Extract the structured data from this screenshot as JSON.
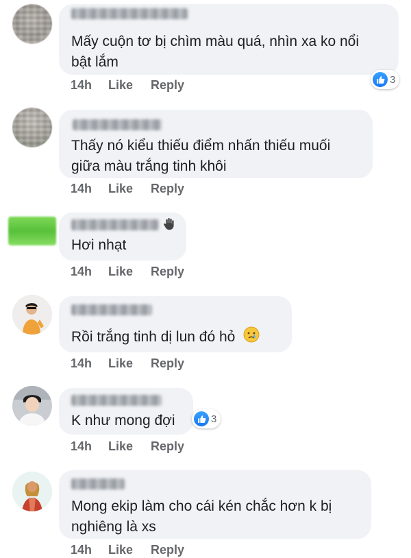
{
  "comments": [
    {
      "text_line1": "Mấy cuộn tơ bị chìm màu quá, nhìn xa ko nổi",
      "text_line2": "bật lắm",
      "time": "14h",
      "like": "Like",
      "reply": "Reply",
      "reaction_count": "3",
      "reaction_icon": "like-icon"
    },
    {
      "text_line1": "Thấy nó kiểu thiếu điểm nhấn thiếu muối",
      "text_line2": "giữa màu trắng tinh khôi",
      "time": "14h",
      "like": "Like",
      "reply": "Reply"
    },
    {
      "text_line1": "Hơi nhạt",
      "time": "14h",
      "like": "Like",
      "reply": "Reply",
      "name_icon": "wave-hand-icon"
    },
    {
      "text_line1": "Rồi trắng tinh dị lun đó hỏ",
      "emoji": "crying-face-icon",
      "time": "14h",
      "like": "Like",
      "reply": "Reply"
    },
    {
      "text_line1": "K như mong đợi",
      "time": "14h",
      "like": "Like",
      "reply": "Reply",
      "reaction_count": "3",
      "reaction_icon": "like-icon"
    },
    {
      "text_line1": "Mong ekip làm cho cái kén chắc hơn k bị",
      "text_line2": "nghiêng là xs",
      "time": "14h",
      "like": "Like",
      "reply": "Reply"
    }
  ],
  "colors": {
    "bubble": "#f0f2f5",
    "meta_text": "#65676b",
    "like_blue": "#1877f2"
  }
}
